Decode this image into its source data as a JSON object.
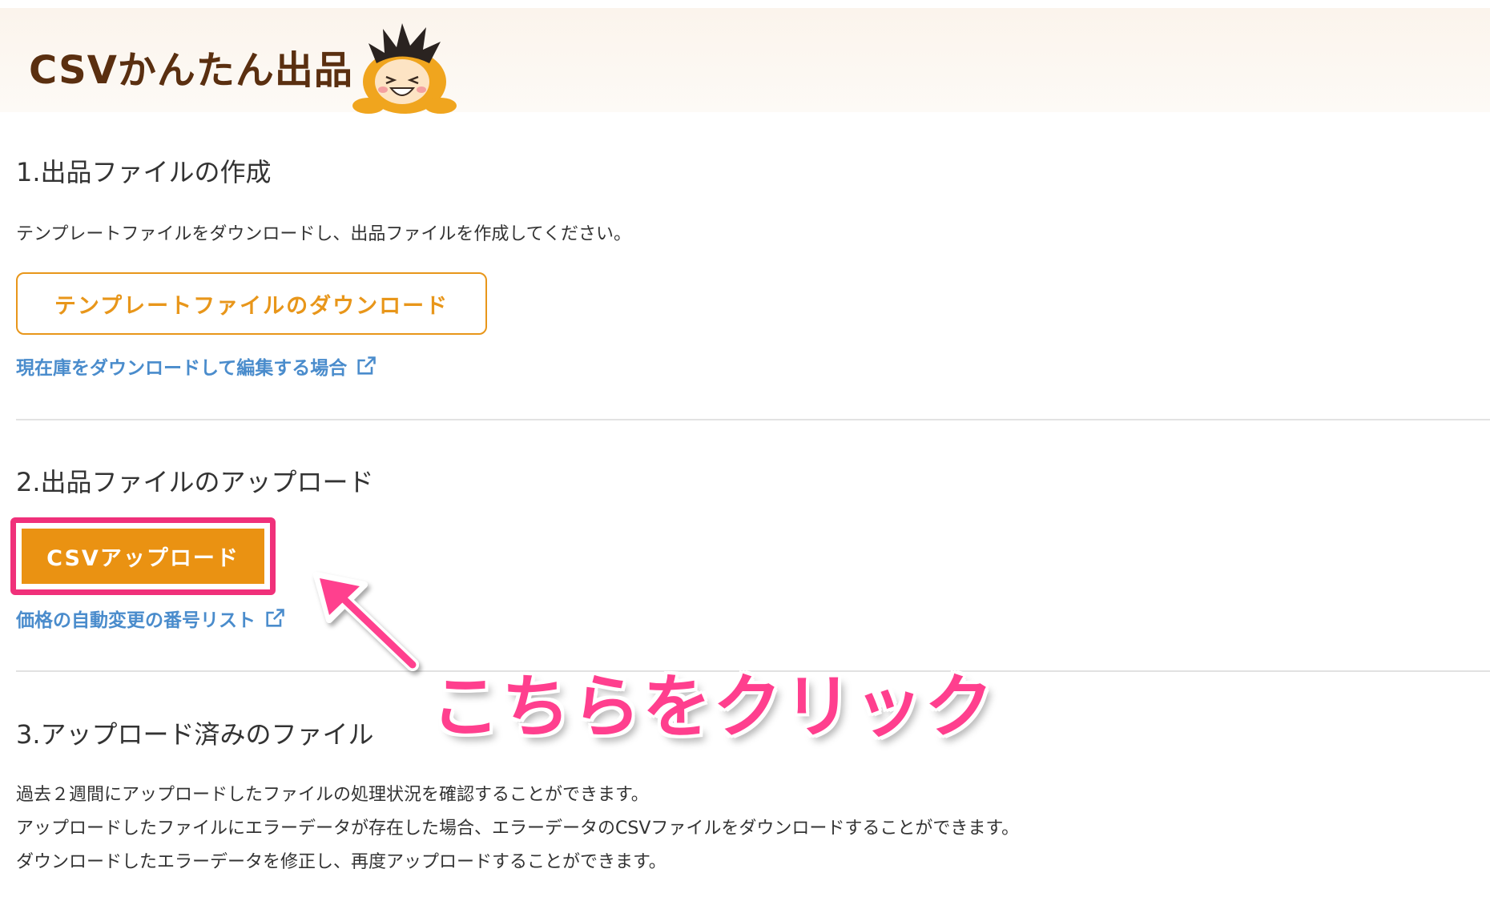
{
  "header": {
    "title": "CSVかんたん出品"
  },
  "section1": {
    "heading": "1.出品ファイルの作成",
    "description": "テンプレートファイルをダウンロードし、出品ファイルを作成してください。",
    "download_button_label": "テンプレートファイルのダウンロード",
    "stock_link_label": "現在庫をダウンロードして編集する場合"
  },
  "section2": {
    "heading": "2.出品ファイルのアップロード",
    "upload_button_label": "CSVアップロード",
    "price_link_label": "価格の自動変更の番号リスト"
  },
  "section3": {
    "heading": "3.アップロード済みのファイル",
    "lines": [
      "過去２週間にアップロードしたファイルの処理状況を確認することができます。",
      "アップロードしたファイルにエラーデータが存在した場合、エラーデータのCSVファイルをダウンロードすることができます。",
      "ダウンロードしたエラーデータを修正し、再度アップロードすることができます。"
    ]
  },
  "annotation": {
    "callout_text": "こちらをクリック"
  },
  "colors": {
    "brand_orange": "#ea9212",
    "link_blue": "#4a8ccc",
    "highlight_pink": "#f0307a",
    "header_text": "#5a2f10"
  },
  "icons": {
    "external_link": "external-link-icon",
    "mascot": "mascot-icon",
    "arrow": "arrow-annotation-icon"
  }
}
